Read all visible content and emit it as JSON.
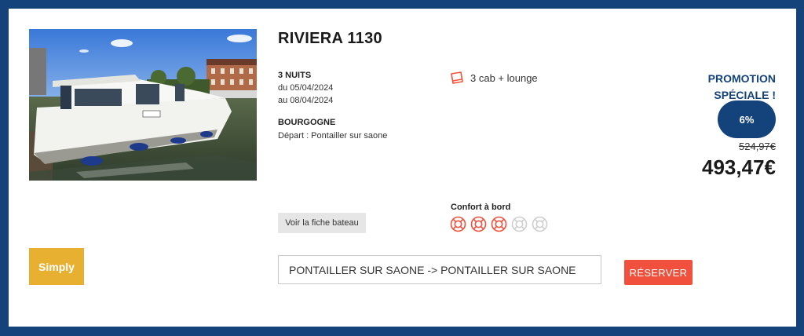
{
  "listing": {
    "title": "RIVIERA 1130",
    "nights": "3 NUITS",
    "date_from": "du 05/04/2024",
    "date_to": "au 08/04/2024",
    "region": "BOURGOGNE",
    "departure": "Départ : Pontailler sur saone",
    "cabins": "3 cab + lounge",
    "promo_line1": "PROMOTION",
    "promo_line2": "SPÉCIALE !",
    "discount": "6%",
    "old_price": "524,97€",
    "price": "493,47€",
    "fiche_button": "Voir la fiche bateau",
    "comfort_label": "Confort à bord",
    "comfort_level": 3,
    "comfort_max": 5,
    "category_badge": "Simply",
    "route": "PONTAILLER SUR SAONE -> PONTAILLER SUR SAONE",
    "reserve_button": "RÉSERVER"
  },
  "colors": {
    "frame": "#14427a",
    "accent": "#f0503c",
    "badge": "#e8b030"
  },
  "icons": {
    "cabins": "bed-icon",
    "comfort": "lifebuoy-icon"
  }
}
